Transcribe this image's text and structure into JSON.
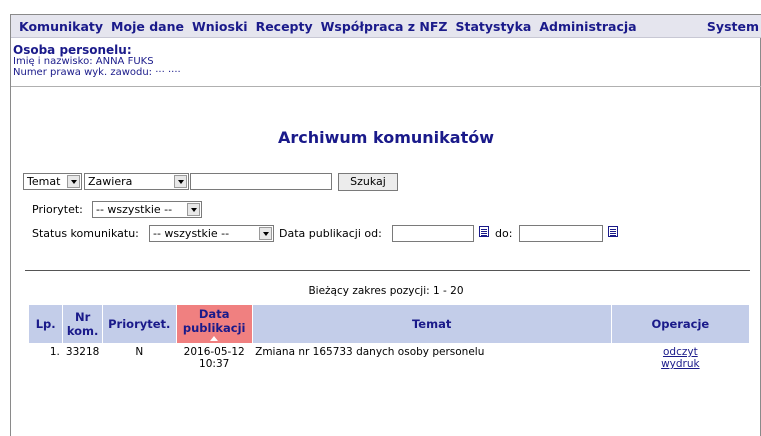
{
  "menu": [
    "Komunikaty",
    "Moje dane",
    "Wnioski",
    "Recepty",
    "Współpraca z NFZ",
    "Statystyka",
    "Administracja",
    "System"
  ],
  "person": {
    "header": "Osoba personelu:",
    "name_label": "Imię i nazwisko:",
    "name_value": "ANNA FUKS",
    "license_label": "Numer prawa wyk. zawodu:",
    "license_value": "··· ····"
  },
  "page_title": "Archiwum komunikatów",
  "search": {
    "field_select": "Temat",
    "mode_select": "Zawiera",
    "text_value": "",
    "button": "Szukaj"
  },
  "priority": {
    "label": "Priorytet:",
    "value": "-- wszystkie --"
  },
  "status": {
    "label": "Status komunikatu:",
    "value": "-- wszystkie --"
  },
  "pub_date": {
    "from_label": "Data publikacji od:",
    "to_label": "do:",
    "from_value": "",
    "to_value": ""
  },
  "range_text": "Bieżący zakres pozycji: 1 - 20",
  "table": {
    "headers": {
      "lp": "Lp.",
      "nr_line1": "Nr",
      "nr_line2": "kom.",
      "priority": "Priorytet.",
      "date_line1": "Data",
      "date_line2": "publikacji",
      "subject": "Temat",
      "ops": "Operacje"
    },
    "rows": [
      {
        "lp": "1.",
        "nr": "33218",
        "priority": "N",
        "date": "2016-05-12",
        "time": "10:37",
        "subject": "Zmiana nr 165733 danych osoby personelu",
        "op_read": "odczyt",
        "op_print": "wydruk"
      }
    ]
  },
  "colors": {
    "menu_text": "#1a1a8a",
    "header_bg": "#c3cde9",
    "sorted_header_bg": "#f08080"
  }
}
